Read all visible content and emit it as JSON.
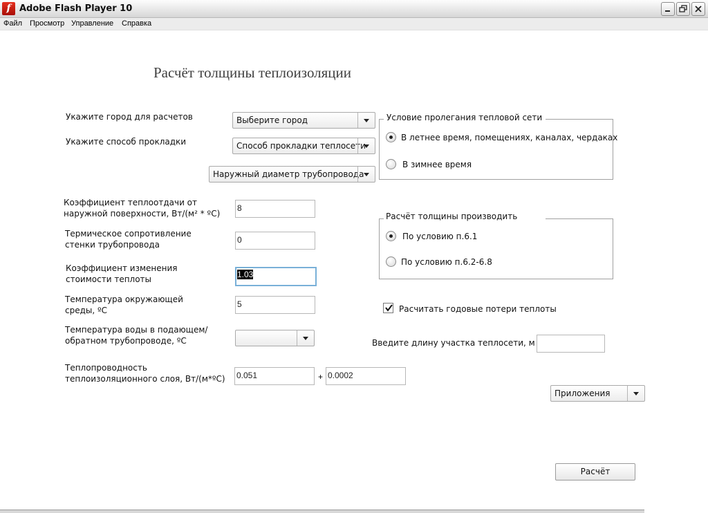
{
  "window": {
    "title": "Adobe Flash Player 10",
    "icon": "flash-player-icon"
  },
  "menu": [
    "Файл",
    "Просмотр",
    "Управление",
    "Справка"
  ],
  "page_title": "Расчёт толщины теплоизоляции",
  "city": {
    "label": "Укажите город для расчетов",
    "value": "Выберите город"
  },
  "laying": {
    "label": "Укажите способ прокладки",
    "value": "Способ прокладки теплосети"
  },
  "diameter": {
    "value": "Наружный диаметр трубопровода"
  },
  "heat_transfer": {
    "label1": "Коэффициент теплоотдачи от",
    "label2": "наружной поверхности, Вт/(м² * ºС)",
    "value": "8"
  },
  "wall_resistance": {
    "label1": "Термическое сопротивление",
    "label2": "стенки трубопровода",
    "value": "0"
  },
  "cost_coef": {
    "label1": "Коэффициент изменения",
    "label2": "стоимости теплоты",
    "value": "1.03"
  },
  "ambient_temp": {
    "label1": "Температура окружающей",
    "label2": "среды, ºС",
    "value": "5"
  },
  "water_temp": {
    "label1": "Температура воды в подающем/",
    "label2": "обратном трубопроводе, ºС",
    "value": ""
  },
  "conductivity": {
    "label1": "Теплопроводность",
    "label2": "теплоизоляционного слоя, Вт/(м*ºС)",
    "value1": "0.051",
    "plus": "+",
    "value2": "0.0002"
  },
  "laying_condition": {
    "legend": "Условие пролегания тепловой сети",
    "options": [
      {
        "label": "В летнее время, помещениях, каналах, чердаках",
        "checked": true
      },
      {
        "label": "В зимнее время",
        "checked": false
      }
    ]
  },
  "calc_by": {
    "legend": "Расчёт толщины производить",
    "options": [
      {
        "label": "По условию п.6.1",
        "checked": true
      },
      {
        "label": "По условию п.6.2-6.8",
        "checked": false
      }
    ]
  },
  "annual_losses": {
    "label": "Расчитать годовые потери теплоты",
    "checked": true
  },
  "section_length": {
    "label": "Введите длину участка теплосети, м",
    "value": ""
  },
  "appendix": {
    "value": "Приложения"
  },
  "calculate_button": "Расчёт"
}
